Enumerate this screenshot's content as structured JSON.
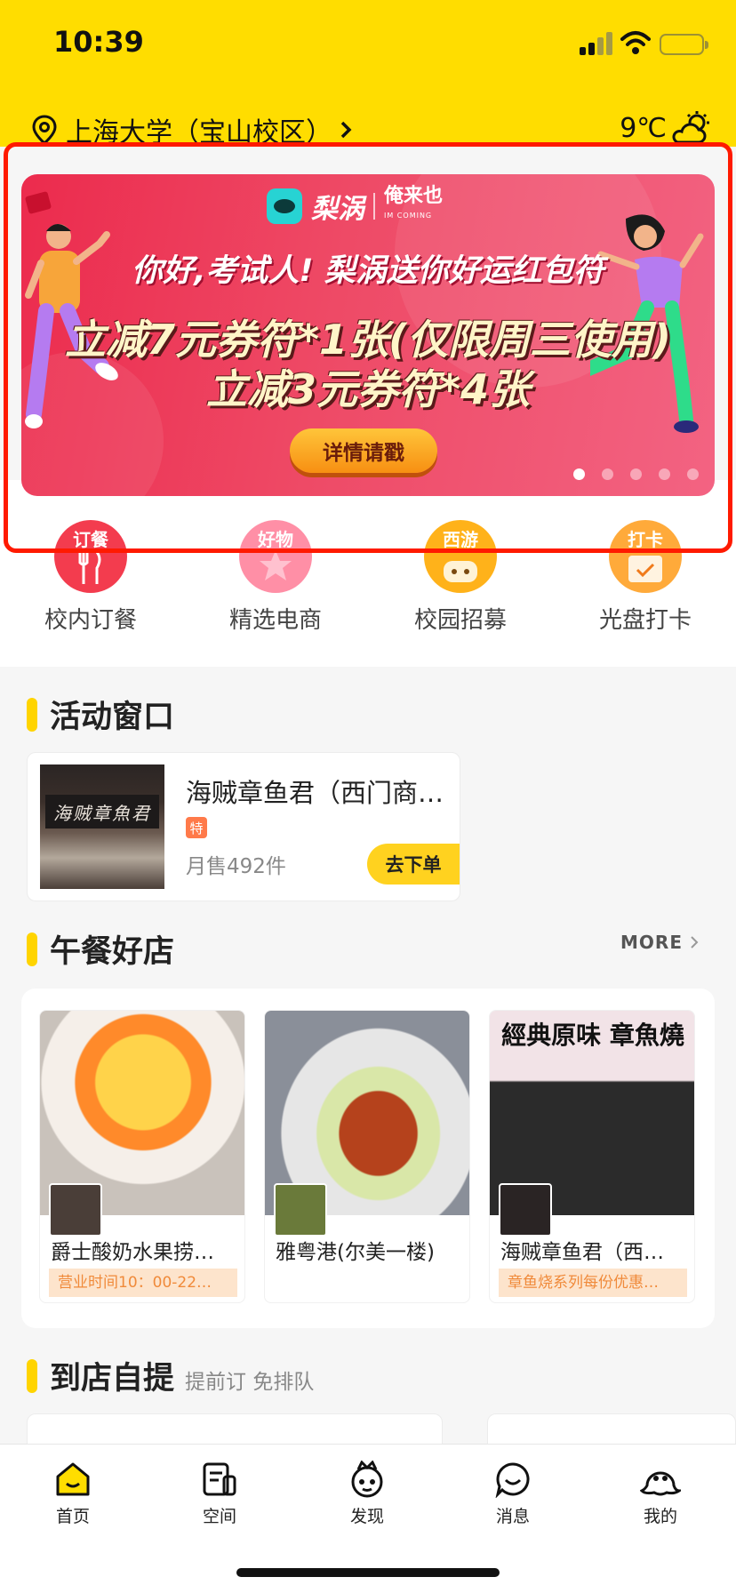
{
  "status_bar": {
    "time": "10:39"
  },
  "location": {
    "name": "上海大学（宝山校区）",
    "icon": "location-pin-icon"
  },
  "weather": {
    "temperature": "9℃",
    "icon": "partly-cloudy-icon"
  },
  "banner": {
    "brand_1": "梨涡",
    "brand_2": "俺来也",
    "brand_2_sub": "IM COMING",
    "line_1": "你好,考试人! 梨涡送你好运红包符",
    "line_2": "立减7元券符*1张(仅限周三使用)",
    "line_3": "立减3元券符*4张",
    "button": "详情请戳",
    "slide_count": 5,
    "active_slide": 1,
    "background": "#ec2b4d"
  },
  "quick_nav": [
    {
      "label": "校内订餐",
      "tag": "订餐",
      "color": "#f33c4e"
    },
    {
      "label": "精选电商",
      "tag": "好物",
      "color": "#ff8fa6"
    },
    {
      "label": "校园招募",
      "tag": "西游",
      "color": "#ffb21a"
    },
    {
      "label": "光盘打卡",
      "tag": "打卡",
      "color": "#ffaa3a"
    }
  ],
  "activity": {
    "title": "活动窗口",
    "card": {
      "sign_text": "海贼章魚君",
      "name": "海贼章鱼君（西门商…",
      "tag": "特",
      "sales": "月售492件",
      "button": "去下单"
    }
  },
  "lunch": {
    "title": "午餐好店",
    "more": "MORE",
    "shops": [
      {
        "name": "爵士酸奶水果捞…",
        "note": "营业时间10：00-22…",
        "image_text": ""
      },
      {
        "name": "雅粤港(尔美一楼)",
        "note": "",
        "image_text": ""
      },
      {
        "name": "海贼章鱼君（西…",
        "note": "章鱼烧系列每份优惠…",
        "image_text": "經典原味 章魚燒"
      }
    ]
  },
  "pickup": {
    "title": "到店自提",
    "subtitle": "提前订 免排队"
  },
  "tab_bar": [
    {
      "label": "首页",
      "icon": "home-icon",
      "active": true
    },
    {
      "label": "空间",
      "icon": "space-icon",
      "active": false
    },
    {
      "label": "发现",
      "icon": "discover-icon",
      "active": false
    },
    {
      "label": "消息",
      "icon": "message-icon",
      "active": false
    },
    {
      "label": "我的",
      "icon": "profile-icon",
      "active": false
    }
  ],
  "colors": {
    "brand_yellow": "#ffdd00",
    "accent_orange": "#f08a3a",
    "highlight_frame": "#ff1a00"
  }
}
